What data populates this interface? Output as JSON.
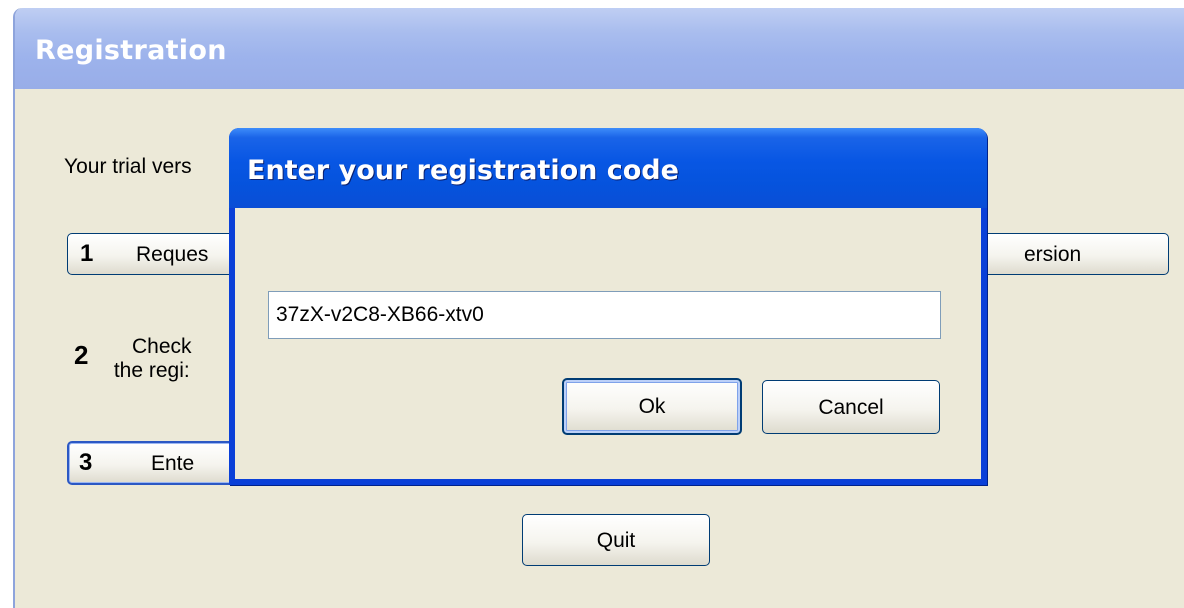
{
  "window": {
    "title": "Registration",
    "trial_text": "Your trial vers",
    "step1": {
      "number": "1",
      "label": "Reques",
      "label_right": "ersion"
    },
    "step2": {
      "number": "2",
      "line1": "Check",
      "line2": "the regi:"
    },
    "step3": {
      "number": "3",
      "label": "Ente"
    },
    "quit_label": "Quit"
  },
  "dialog": {
    "title": "Enter your registration code",
    "code_value": "37zX-v2C8-XB66-xtv0",
    "ok_label": "Ok",
    "cancel_label": "Cancel"
  },
  "colors": {
    "dialog_titlebar": "#0553dd",
    "window_bg": "#ece9d8",
    "inactive_titlebar": "#9db3ec"
  }
}
